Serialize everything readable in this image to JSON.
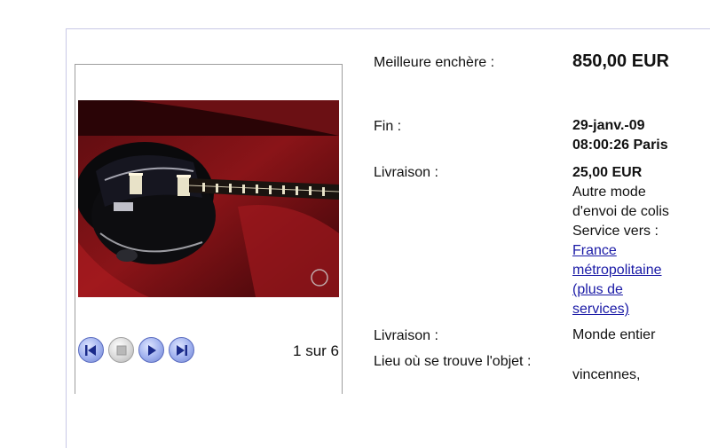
{
  "gallery": {
    "counter": "1 sur 6",
    "controls": [
      {
        "name": "previous-button",
        "icon": "rewind-icon"
      },
      {
        "name": "stop-button",
        "icon": "stop-icon"
      },
      {
        "name": "play-button",
        "icon": "play-icon"
      },
      {
        "name": "next-button",
        "icon": "fast-forward-icon"
      }
    ]
  },
  "details": {
    "best_bid_label": "Meilleure enchère :",
    "best_bid_value": "850,00 EUR",
    "end_label": "Fin :",
    "end_date": "29-janv.-09",
    "end_time": "08:00:26 Paris",
    "shipping_label": "Livraison :",
    "shipping_cost": "25,00 EUR",
    "shipping_method_1": "Autre mode",
    "shipping_method_2": "d'envoi de colis",
    "service_to": "Service vers :",
    "service_link_1": "France",
    "service_link_2": "métropolitaine",
    "more_services_1": "(plus de",
    "more_services_2": "services)",
    "delivery_label": "Livraison :",
    "delivery_value": "Monde entier",
    "location_label": "Lieu où se trouve l'objet :",
    "location_value": "vincennes,"
  },
  "colors": {
    "link": "#1a1aa6",
    "panel_border": "#c8c8e6",
    "control_blue": "#6f82cf"
  }
}
